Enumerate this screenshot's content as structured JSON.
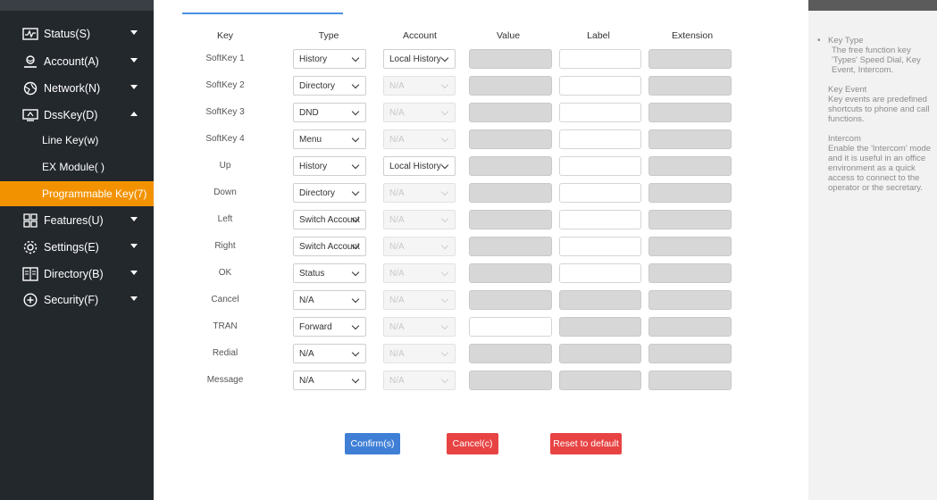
{
  "sidebar": {
    "items": [
      {
        "label": "Status(S)",
        "icon": "status-icon"
      },
      {
        "label": "Account(A)",
        "icon": "account-icon"
      },
      {
        "label": "Network(N)",
        "icon": "network-icon"
      },
      {
        "label": "DssKey(D)",
        "icon": "dsskey-icon"
      },
      {
        "label": "Features(U)",
        "icon": "features-icon"
      },
      {
        "label": "Settings(E)",
        "icon": "settings-icon"
      },
      {
        "label": "Directory(B)",
        "icon": "directory-icon"
      },
      {
        "label": "Security(F)",
        "icon": "security-icon"
      }
    ],
    "subitems": [
      {
        "label": "Line Key(w)"
      },
      {
        "label": "EX Module( )"
      },
      {
        "label": "Programmable Key(7)"
      }
    ],
    "active_color": "#f39200"
  },
  "table": {
    "headers": {
      "key": "Key",
      "type": "Type",
      "account": "Account",
      "value": "Value",
      "label": "Label",
      "extension": "Extension"
    },
    "rows": [
      {
        "key": "SoftKey 1",
        "type": "History",
        "account": "Local History",
        "account_enabled": true,
        "label_enabled": true,
        "value_enabled": false
      },
      {
        "key": "SoftKey 2",
        "type": "Directory",
        "account": "N/A",
        "account_enabled": false,
        "label_enabled": true,
        "value_enabled": false
      },
      {
        "key": "SoftKey 3",
        "type": "DND",
        "account": "N/A",
        "account_enabled": false,
        "label_enabled": true,
        "value_enabled": false
      },
      {
        "key": "SoftKey 4",
        "type": "Menu",
        "account": "N/A",
        "account_enabled": false,
        "label_enabled": true,
        "value_enabled": false
      },
      {
        "key": "Up",
        "type": "History",
        "account": "Local History",
        "account_enabled": true,
        "label_enabled": true,
        "value_enabled": false
      },
      {
        "key": "Down",
        "type": "Directory",
        "account": "N/A",
        "account_enabled": false,
        "label_enabled": true,
        "value_enabled": false
      },
      {
        "key": "Left",
        "type": "Switch Account",
        "account": "N/A",
        "account_enabled": false,
        "label_enabled": true,
        "value_enabled": false
      },
      {
        "key": "Right",
        "type": "Switch Account",
        "account": "N/A",
        "account_enabled": false,
        "label_enabled": true,
        "value_enabled": false
      },
      {
        "key": "OK",
        "type": "Status",
        "account": "N/A",
        "account_enabled": false,
        "label_enabled": true,
        "value_enabled": false
      },
      {
        "key": "Cancel",
        "type": "N/A",
        "account": "N/A",
        "account_enabled": false,
        "label_enabled": false,
        "value_enabled": false
      },
      {
        "key": "TRAN",
        "type": "Forward",
        "account": "N/A",
        "account_enabled": false,
        "label_enabled": false,
        "value_enabled": true
      },
      {
        "key": "Redial",
        "type": "N/A",
        "account": "N/A",
        "account_enabled": false,
        "label_enabled": false,
        "value_enabled": false
      },
      {
        "key": "Message",
        "type": "N/A",
        "account": "N/A",
        "account_enabled": false,
        "label_enabled": false,
        "value_enabled": false
      }
    ]
  },
  "buttons": {
    "confirm": "Confirm(s)",
    "cancel": "Cancel(c)",
    "reset": "Reset to default",
    "confirm_color": "#3f7fd6",
    "cancel_color": "#e84343"
  },
  "help": {
    "bullet": "•",
    "sections": [
      {
        "title": "Key Type",
        "body": "The free function key 'Types' Speed Dial, Key Event, Intercom."
      },
      {
        "title": "Key Event",
        "body": "Key events are predefined shortcuts to phone and call functions."
      },
      {
        "title": "Intercom",
        "body": "Enable the 'Intercom' mode and it is useful in an office environment as a quick access to connect to the operator or the secretary."
      }
    ]
  }
}
